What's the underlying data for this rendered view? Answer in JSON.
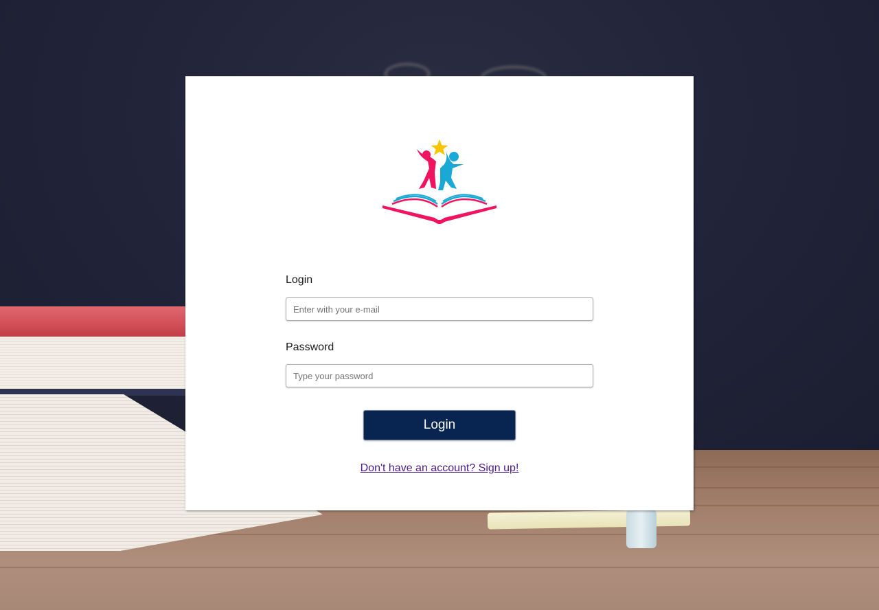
{
  "login_form": {
    "login_label": "Login",
    "email_placeholder": "Enter with your e-mail",
    "password_label": "Password",
    "password_placeholder": "Type your password",
    "submit_label": "Login",
    "signup_link": "Don't have an account? Sign up!"
  },
  "logo": {
    "icon": "children-reading-book-logo",
    "colors": {
      "pink": "#f0135f",
      "blue": "#1aa9d6",
      "star": "#f6c500"
    }
  },
  "theme": {
    "button_bg": "#082552",
    "link_color": "#4b1a8a"
  }
}
